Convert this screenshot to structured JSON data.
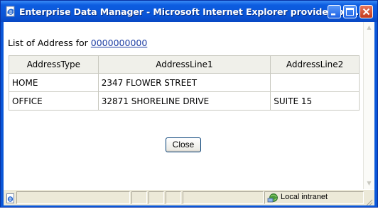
{
  "window": {
    "title": "Enterprise Data Manager - Microsoft Internet Explorer provided by ..."
  },
  "content": {
    "list_label": "List of Address for",
    "account_link": "0000000000",
    "table": {
      "headers": [
        "AddressType",
        "AddressLine1",
        "AddressLine2"
      ],
      "rows": [
        [
          "HOME",
          "2347 FLOWER STREET",
          ""
        ],
        [
          "OFFICE",
          "32871 SHORELINE DRIVE",
          "SUITE 15"
        ]
      ]
    },
    "close_button": "Close"
  },
  "statusbar": {
    "zone": "Local intranet"
  },
  "icons": {
    "title": "ie-page-icon",
    "minimize": "minimize-icon",
    "maximize": "maximize-icon",
    "close": "close-icon",
    "status_page": "ie-page-icon",
    "zone": "local-intranet-icon"
  },
  "colors": {
    "titlebar": "#0a54d6",
    "link": "#1c3da3",
    "header_bg": "#f0f0ea"
  }
}
